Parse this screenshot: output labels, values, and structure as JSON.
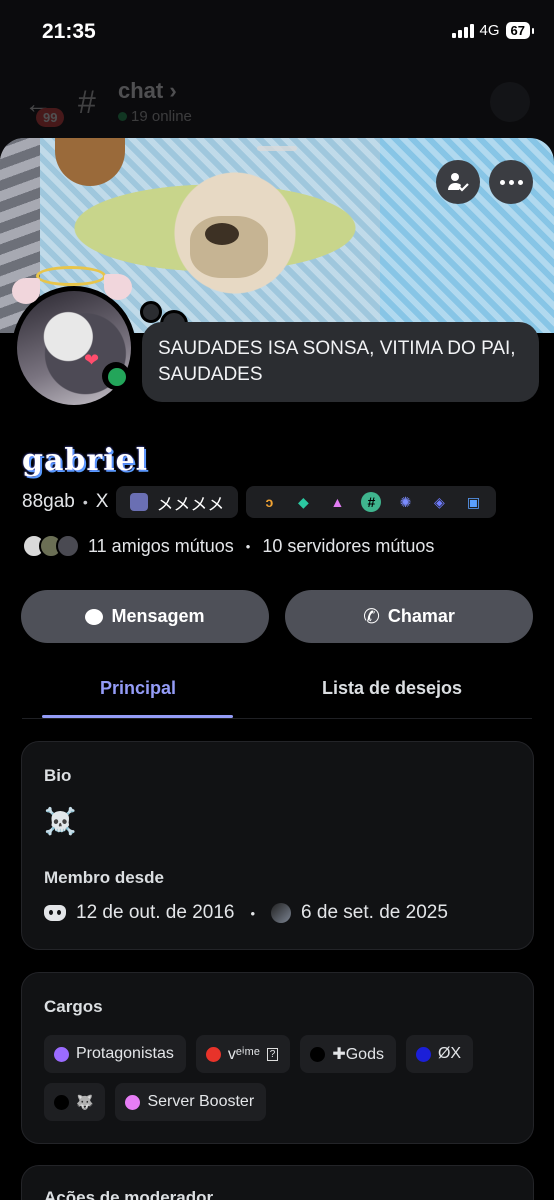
{
  "status_bar": {
    "time": "21:35",
    "network": "4G",
    "battery": "67"
  },
  "background_chat": {
    "unread": "99",
    "channel": "chat",
    "online": "19 online"
  },
  "profile": {
    "display_name": "gabriel",
    "username": "88gab",
    "pronouns": "X",
    "guild_tag": "メメメメ",
    "custom_status": "SAUDADES ISA SONSA, VITIMA DO PAI, SAUDADES",
    "badges": [
      "hypesquad-icon",
      "quest-icon",
      "triangle-icon",
      "hash-icon",
      "gear-badge-icon",
      "nitro-icon",
      "gift-icon"
    ],
    "mutual_friends": "11 amigos mútuos",
    "mutual_servers": "10 servidores mútuos"
  },
  "actions": {
    "message": "Mensagem",
    "call": "Chamar"
  },
  "tabs": [
    {
      "label": "Principal",
      "active": true
    },
    {
      "label": "Lista de desejos",
      "active": false
    }
  ],
  "about": {
    "bio_title": "Bio",
    "bio_value": "☠️",
    "member_since_title": "Membro desde",
    "discord_date": "12 de out. de 2016",
    "server_date": "6 de set. de 2025"
  },
  "roles": {
    "title": "Cargos",
    "items": [
      {
        "name": "Protagonistas",
        "color": "#9b6bff"
      },
      {
        "name": "vᵉⁱᵐᵉ",
        "color": "#e8332a",
        "emblem": "?"
      },
      {
        "name": "✚Gods",
        "color": "#000000"
      },
      {
        "name": "ØX",
        "color": "#1b1fd8"
      },
      {
        "name": "",
        "color": "#000000",
        "emblem": "🐺"
      },
      {
        "name": "Server Booster",
        "color": "#e67df5"
      }
    ]
  },
  "moderator": {
    "title": "Ações de moderador"
  },
  "colors": {
    "accent": "#949cf7",
    "online": "#23a55a",
    "card_bg": "#111214",
    "button_bg": "#4e5058"
  }
}
